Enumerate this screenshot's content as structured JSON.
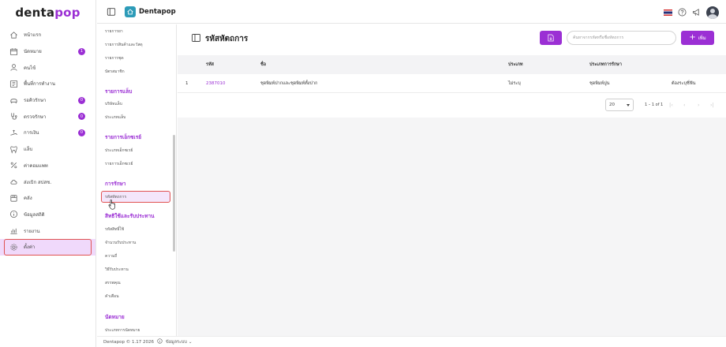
{
  "brand": {
    "logo_main": "denta",
    "logo_accent": "pop",
    "app_name": "Dentapop"
  },
  "nav": {
    "items": [
      {
        "label": "หน้าแรก",
        "icon": "home-icon"
      },
      {
        "label": "นัดหมาย",
        "icon": "calendar-icon",
        "badge": "1"
      },
      {
        "label": "คนไข้",
        "icon": "user-icon"
      },
      {
        "label": "พื้นที่การทำงาน",
        "icon": "workspace-icon"
      },
      {
        "label": "รอคิวรักษา",
        "icon": "chair-icon",
        "badge": "0"
      },
      {
        "label": "ตรวจรักษา",
        "icon": "stethoscope-icon",
        "badge": "0"
      },
      {
        "label": "การเงิน",
        "icon": "money-icon",
        "badge": "0"
      },
      {
        "label": "แล็บ",
        "icon": "tooth-icon"
      },
      {
        "label": "ค่าคอมแพท",
        "icon": "percent-icon"
      },
      {
        "label": "ส่งเบิก สปสช.",
        "icon": "cloud-icon"
      },
      {
        "label": "คลัง",
        "icon": "inventory-icon"
      },
      {
        "label": "ข้อมูลสถิติ",
        "icon": "info-icon"
      },
      {
        "label": "รายงาน",
        "icon": "report-icon"
      },
      {
        "label": "ตั้งค่า",
        "icon": "gear-icon",
        "active": true
      }
    ]
  },
  "submenu": {
    "items_top": [
      "รายการยา",
      "รายการสินค้าและวัสดุ",
      "รายการชุด",
      "บัตรสมาชิก"
    ],
    "group_lab": {
      "title": "รายการแล็บ",
      "items": [
        "บริษัทแล็บ",
        "ประเภทแล็บ"
      ]
    },
    "group_xray": {
      "title": "รายการเอ็กซเรย์",
      "items": [
        "ประเภทเอ็กซเรย์",
        "รายการเอ็กซเรย์"
      ]
    },
    "group_treatment": {
      "title": "การรักษา",
      "items": [
        "รหัสหัตถการ"
      ]
    },
    "group_rights": {
      "title": "สิทธิใช้และรับประทาน",
      "items": [
        "รหัสสิทธิ์ใช้",
        "จำนวนรับประทาน",
        "ความถี่",
        "วิธีรับประทาน",
        "สรรพคุณ",
        "คำเตือน"
      ]
    },
    "group_appointment": {
      "title": "นัดหมาย",
      "items": [
        "ประเภทการนัดหมาย"
      ]
    }
  },
  "main": {
    "title": "รหัสหัตถการ",
    "search_placeholder": "ค้นหาจากรหัสหรือชื่อหัตถการ",
    "add_label": "เพิ่ม",
    "columns": [
      "รหัส",
      "ชื่อ",
      "ประเภท",
      "ประเภทการรักษา"
    ],
    "rows": [
      {
        "index": "1",
        "code": "2387010",
        "name": "ชุดพิมพ์ปากและชุดพิมพ์ทั้งปาก",
        "type": "ไม่ระบุ",
        "treatment_type": "ชุดพิมพ์ปูน",
        "action": "ต้องระบุซี่ฟัน"
      }
    ],
    "pagination": {
      "rows_per_page": "20",
      "info": "1 – 1 of 1"
    }
  },
  "footer": {
    "copyright": "Dentapop © 1.17 2026",
    "system_info": "ข้อมูลระบบ"
  },
  "colors": {
    "accent": "#9b2fd4",
    "highlight_border": "#e05252"
  }
}
